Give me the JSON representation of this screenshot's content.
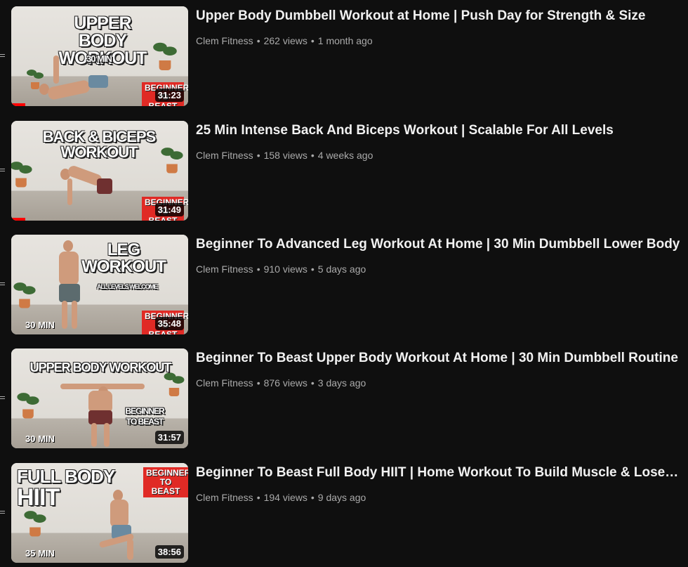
{
  "videos": [
    {
      "thumb_title": "UPPER BODY WORKOUT",
      "thumb_line1": "UPPER BODY",
      "thumb_line2": "WORKOUT",
      "thumb_sub": "30 MIN",
      "badge": "BEGINNER TO BEAST",
      "corner": "",
      "duration": "31:23",
      "title": "Upper Body Dumbbell Workout at Home | Push Day for Strength & Size",
      "channel": "Clem Fitness",
      "views": "262 views",
      "age": "1 month ago",
      "watched_fraction": 0.08
    },
    {
      "thumb_line1": "BACK & BICEPS",
      "thumb_line2": "WORKOUT",
      "thumb_sub": "",
      "badge": "BEGINNER TO BEAST",
      "corner": "",
      "duration": "31:49",
      "title": "25 Min Intense Back And Biceps Workout | Scalable For All Levels",
      "channel": "Clem Fitness",
      "views": "158 views",
      "age": "4 weeks ago",
      "watched_fraction": 0.08
    },
    {
      "thumb_line1": "LEG",
      "thumb_line2": "WORKOUT",
      "thumb_sub": "ALL LEVELS WELCOME",
      "badge": "BEGINNER TO BEAST",
      "corner": "30 MIN",
      "duration": "35:48",
      "title": "Beginner To Advanced Leg Workout At Home | 30 Min Dumbbell Lower Body",
      "channel": "Clem Fitness",
      "views": "910 views",
      "age": "5 days ago",
      "watched_fraction": 0
    },
    {
      "thumb_line1": "UPPER BODY WORKOUT",
      "thumb_line2": "",
      "thumb_sub": "BEGINNER TO BEAST",
      "badge": "",
      "corner": "30 MIN",
      "duration": "31:57",
      "title": "Beginner To Beast Upper Body Workout At Home | 30 Min Dumbbell Routine",
      "channel": "Clem Fitness",
      "views": "876 views",
      "age": "3 days ago",
      "watched_fraction": 0
    },
    {
      "thumb_line1": "FULL BODY",
      "thumb_line2": "HIIT",
      "thumb_sub": "",
      "badge": "BEGINNER TO BEAST",
      "corner": "35 MIN",
      "duration": "38:56",
      "title": "Beginner To Beast Full Body HIIT | Home Workout To Build Muscle & Lose…",
      "channel": "Clem Fitness",
      "views": "194 views",
      "age": "9 days ago",
      "watched_fraction": 0
    }
  ],
  "separator": "•"
}
